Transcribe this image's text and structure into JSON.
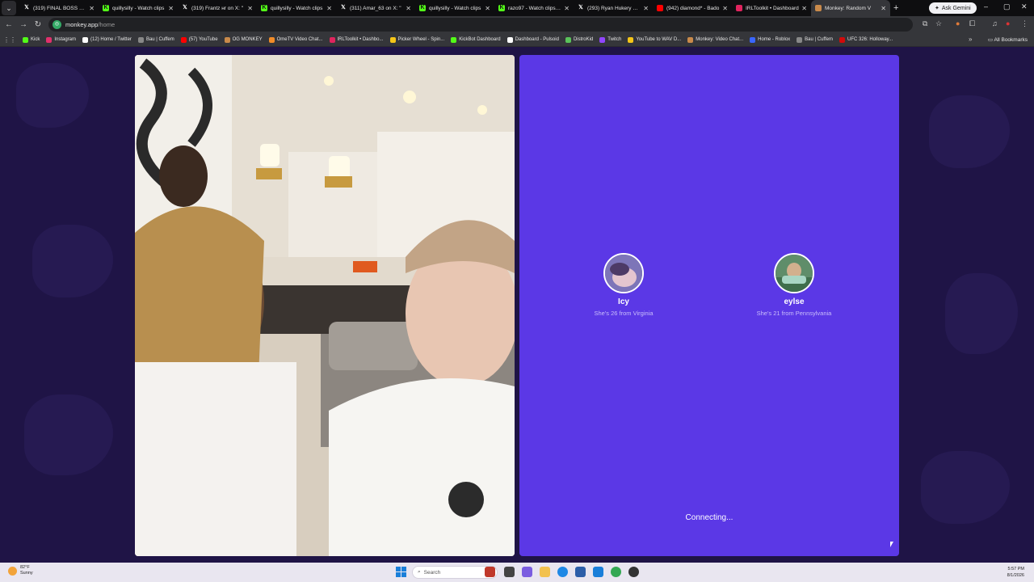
{
  "browser": {
    "tabs": [
      {
        "label": "(319) FINAL BOSS ENE",
        "icon": "x-icon",
        "color": "#ffffff"
      },
      {
        "label": "quillysilly - Watch clips",
        "icon": "kick-icon",
        "color": "#53fc18"
      },
      {
        "label": "(319) Frantz нr on X: \"",
        "icon": "x-icon",
        "color": "#ffffff"
      },
      {
        "label": "quillysilly - Watch clips",
        "icon": "kick-icon",
        "color": "#53fc18"
      },
      {
        "label": "(311) Amar_63 on X: \"",
        "icon": "x-icon",
        "color": "#ffffff"
      },
      {
        "label": "quillysilly - Watch clips",
        "icon": "kick-icon",
        "color": "#53fc18"
      },
      {
        "label": "razo97 - Watch clips on",
        "icon": "kick-icon",
        "color": "#53fc18"
      },
      {
        "label": "(293) Ryan Hukery on X",
        "icon": "x-icon",
        "color": "#ffffff"
      },
      {
        "label": "(942) diamond* - Bado",
        "icon": "youtube-icon",
        "color": "#ff0000"
      },
      {
        "label": "IRLToolkit • Dashboard",
        "icon": "irltoolkit-icon",
        "color": "#e0245e"
      },
      {
        "label": "Monkey: Random V",
        "icon": "monkey-icon",
        "color": "#c98a4b",
        "active": true
      }
    ],
    "ask_gemini": "Ask Gemini",
    "url_host": "monkey.app",
    "url_path": "/home",
    "bookmarks": [
      {
        "label": "Kick",
        "color": "#53fc18"
      },
      {
        "label": "Instagram",
        "color": "#e1306c"
      },
      {
        "label": "(12) Home / Twitter",
        "color": "#ffffff"
      },
      {
        "label": "Bau | Cuffem",
        "color": "#888888"
      },
      {
        "label": "(57) YouTube",
        "color": "#ff0000"
      },
      {
        "label": "OG MONKEY",
        "color": "#c98a4b"
      },
      {
        "label": "OmeTV Video Chat...",
        "color": "#f28c28"
      },
      {
        "label": "IRLToolkit • Dashbo...",
        "color": "#e0245e"
      },
      {
        "label": "Picker Wheel - Spin...",
        "color": "#f5c518"
      },
      {
        "label": "KickBot Dashboard",
        "color": "#53fc18"
      },
      {
        "label": "Dashboard - Pulsoid",
        "color": "#ffffff"
      },
      {
        "label": "DistroKid",
        "color": "#5ac35a"
      },
      {
        "label": "Twitch",
        "color": "#9146ff"
      },
      {
        "label": "YouTube to WAV D...",
        "color": "#f5c518"
      },
      {
        "label": "Monkey: Video Chat...",
        "color": "#c98a4b"
      },
      {
        "label": "Home - Roblox",
        "color": "#3a66ff"
      },
      {
        "label": "Bau | Cuffem",
        "color": "#888888"
      },
      {
        "label": "UFC 326: Holloway...",
        "color": "#d20a0a"
      }
    ],
    "all_bookmarks": "All Bookmarks"
  },
  "monkey": {
    "profiles": [
      {
        "name": "Icy",
        "desc": "She's 26 from Virginia"
      },
      {
        "name": "eylse",
        "desc": "She's 21 from Pennsylvania"
      }
    ],
    "status": "Connecting...",
    "panel_color": "#5b38e6"
  },
  "taskbar": {
    "weather_temp": "82°F",
    "weather_cond": "Sunny",
    "search_placeholder": "Search",
    "time": "5:57 PM",
    "date": "8/1/2026"
  }
}
